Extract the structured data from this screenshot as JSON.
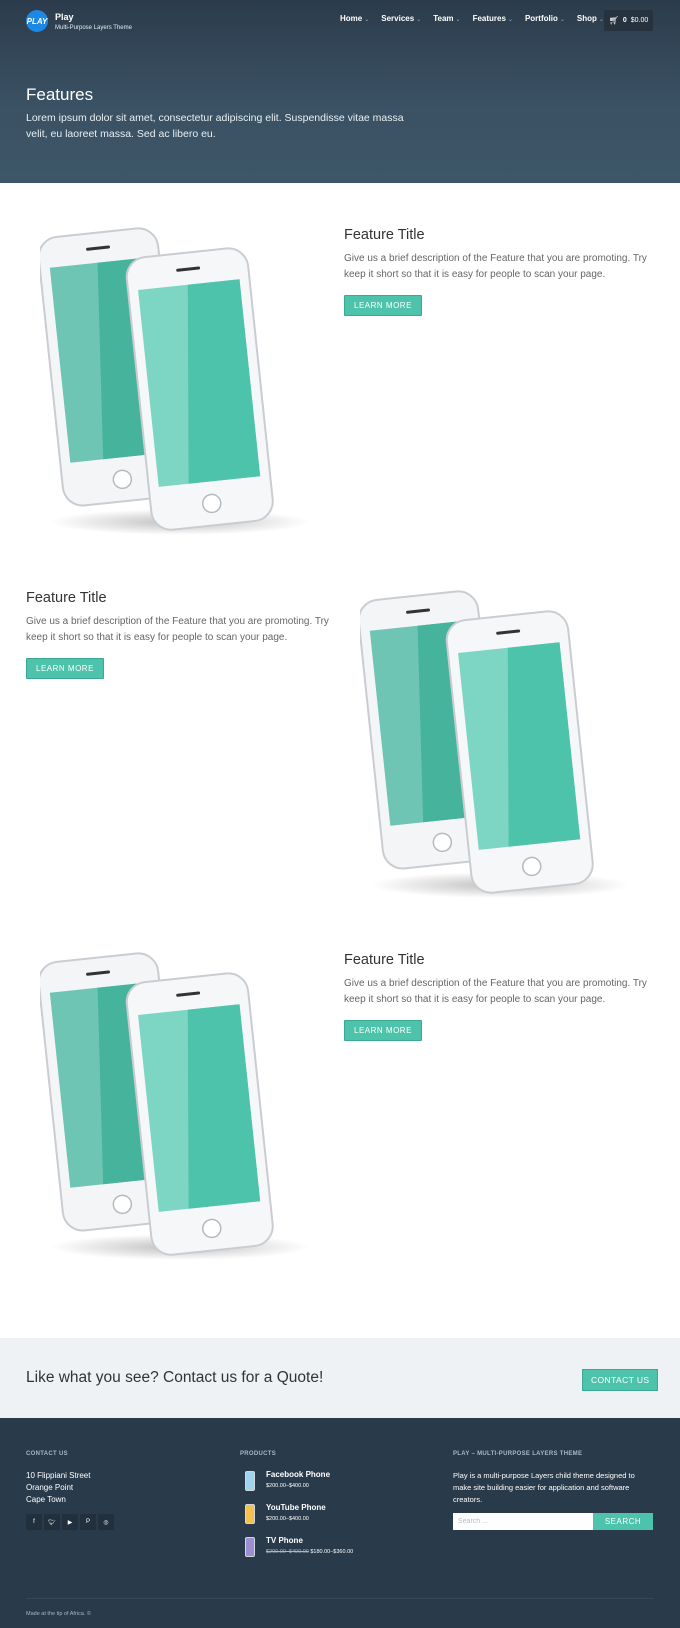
{
  "header": {
    "logo_text": "PLAY",
    "site_name": "Play",
    "tagline": "Multi-Purpose Layers Theme",
    "nav": [
      {
        "label": "Home"
      },
      {
        "label": "Services"
      },
      {
        "label": "Team"
      },
      {
        "label": "Features"
      },
      {
        "label": "Portfolio"
      },
      {
        "label": "Shop"
      }
    ],
    "cart_count": "0",
    "cart_total": "$0.00"
  },
  "hero": {
    "title": "Features",
    "excerpt": "Lorem ipsum dolor sit amet, consectetur adipiscing elit. Suspendisse vitae massa velit, eu laoreet massa. Sed ac libero eu."
  },
  "features": [
    {
      "title": "Feature Title",
      "description": "Give us a brief description of the Feature that you are promoting. Try keep it short so that it is easy for people to scan your page.",
      "button": "LEARN MORE"
    },
    {
      "title": "Feature Title",
      "description": "Give us a brief description of the Feature that you are promoting. Try keep it short so that it is easy for people to scan your page.",
      "button": "LEARN MORE"
    },
    {
      "title": "Feature Title",
      "description": "Give us a brief description of the Feature that you are promoting. Try keep it short so that it is easy for people to scan your page.",
      "button": "LEARN MORE"
    }
  ],
  "cta": {
    "text": "Like what you see? Contact us for a Quote!",
    "button": "CONTACT US"
  },
  "footer": {
    "contact_heading": "CONTACT US",
    "address": [
      "10 Flippiani Street",
      "Orange Point",
      "Cape Town"
    ],
    "socials": [
      "facebook-icon",
      "twitter-icon",
      "youtube-icon",
      "pinterest-icon",
      "dribbble-icon"
    ],
    "products_heading": "PRODUCTS",
    "products": [
      {
        "name": "Facebook Phone",
        "price": "$200.00–$400.00",
        "thumb_color": "#9fd3ee"
      },
      {
        "name": "YouTube Phone",
        "price": "$200.00–$400.00",
        "thumb_color": "#f2c14e"
      },
      {
        "name": "TV Phone",
        "old_price": "$200.00–$400.00",
        "price": "$180.00–$360.00",
        "thumb_color": "#9b8fd1"
      }
    ],
    "about_heading": "PLAY – MULTI-PURPOSE LAYERS THEME",
    "about_text": "Play is a multi-purpose Layers child theme designed to make site building easier for application and software creators.",
    "search_placeholder": "Search ...",
    "search_button": "SEARCH",
    "copyright": "Made at the tip of Africa. ©"
  },
  "colors": {
    "accent": "#4ec3ab",
    "hero_bg": "#3a5163",
    "footer_bg": "#293a4a",
    "cta_bg": "#eef2f5"
  }
}
